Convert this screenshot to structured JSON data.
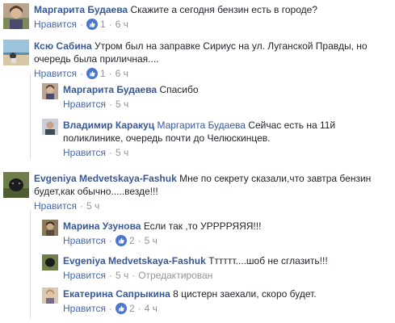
{
  "comments": [
    {
      "author": "Маргарита Будаева",
      "text": "Скажите а сегодня бензин есть в городе?",
      "like_label": "Нравится",
      "likes": "1",
      "time": "6 ч"
    },
    {
      "author": "Ксю Сабина",
      "text": "Утром был на заправке Сириус на ул. Луганской Правды, но очередь была приличная....",
      "like_label": "Нравится",
      "likes": "1",
      "time": "6 ч",
      "replies": [
        {
          "author": "Маргарита Будаева",
          "text": "Спасибо",
          "like_label": "Нравится",
          "time": "5 ч"
        },
        {
          "author": "Владимир Каракуц",
          "mention": "Маргарита Будаева",
          "text": "Сейчас есть на 11й поликлинике, очередь почти до Челюскинцев.",
          "like_label": "Нравится",
          "time": "5 ч"
        }
      ]
    },
    {
      "author": "Evgeniya Medvetskaya-Fashuk",
      "text": "Мне по секрету сказали,что завтра бензин будет,как обычно.....везде!!!",
      "like_label": "Нравится",
      "time": "5 ч",
      "replies": [
        {
          "author": "Марина Узунова",
          "text": "Если так ,то УРРРРЯЯЯ!!!",
          "like_label": "Нравится",
          "likes": "2",
          "time": "5 ч"
        },
        {
          "author": "Evgeniya Medvetskaya-Fashuk",
          "text": "Тттттт....шоб не сглазить!!!",
          "like_label": "Нравится",
          "time": "5 ч",
          "edited_label": "Отредактирован"
        },
        {
          "author": "Екатерина Сапрыкина",
          "text": "8 цистерн заехали, скоро будет.",
          "like_label": "Нравится",
          "likes": "2",
          "time": "4 ч"
        }
      ]
    }
  ],
  "icons": {
    "like": "thumbs-up-icon"
  },
  "colors": {
    "author": "#385898",
    "link": "#4267b2",
    "meta": "#90949c",
    "like_badge": "#4a76d0",
    "thread_line": "#dddfe2"
  }
}
